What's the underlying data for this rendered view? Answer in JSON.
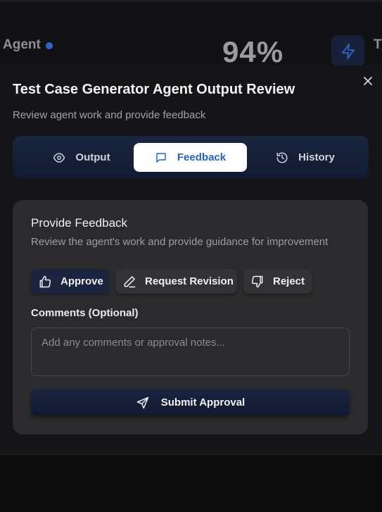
{
  "background": {
    "agent_label": "Agent",
    "percent": "94%",
    "partial_label": "T",
    "status_dot_color": "#2f64c9"
  },
  "modal": {
    "title": "Test Case Generator Agent Output Review",
    "subtitle": "Review agent work and provide feedback",
    "tabs": [
      {
        "label": "Output",
        "icon": "eye-icon"
      },
      {
        "label": "Feedback",
        "icon": "message-square-icon",
        "active": true
      },
      {
        "label": "History",
        "icon": "history-icon"
      }
    ]
  },
  "feedback_card": {
    "title": "Provide Feedback",
    "subtitle": "Review the agent's work and provide guidance for improvement",
    "actions": {
      "approve": "Approve",
      "request_revision": "Request Revision",
      "reject": "Reject"
    },
    "comments_label": "Comments (Optional)",
    "comments_placeholder": "Add any comments or approval notes...",
    "comments_value": "",
    "submit_label": "Submit Approval"
  },
  "colors": {
    "accent_blue": "#2563c9",
    "dark_navy": "#1a2540"
  }
}
